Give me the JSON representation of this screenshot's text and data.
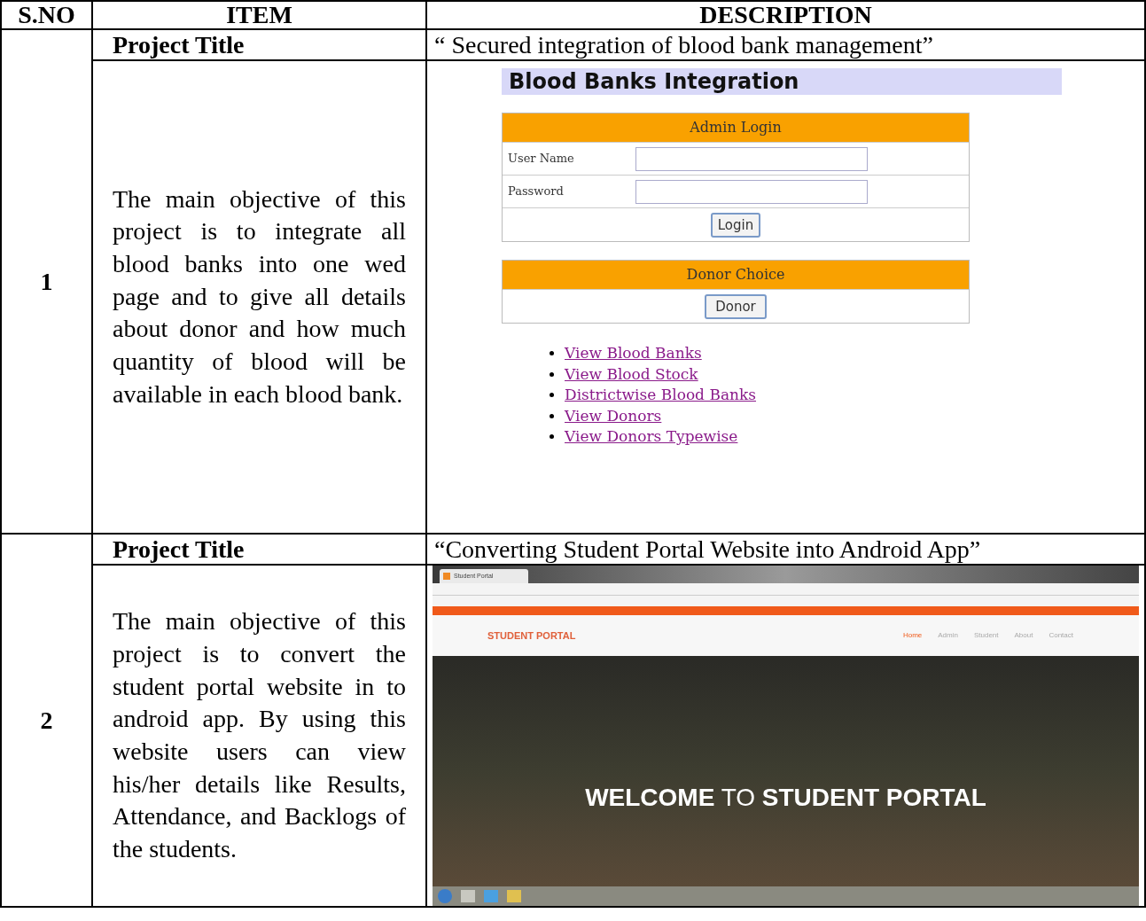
{
  "table": {
    "columns": [
      "S.NO",
      "ITEM",
      "DESCRIPTION"
    ],
    "rows": [
      {
        "number": "1",
        "title_label": "Project Title",
        "title": "“ Secured integration of blood bank management”",
        "objective": "The main objective of this project is to integrate all blood banks into one wed page and to give all details about donor and how much quantity of blood will be available in each blood bank.",
        "screenshot": {
          "kind": "blood_bank",
          "heading": "Blood Banks Integration",
          "login_header": "Admin Login",
          "fields": [
            {
              "label": "User Name"
            },
            {
              "label": "Password"
            }
          ],
          "login_button": "Login",
          "donor_header": "Donor Choice",
          "donor_button": "Donor",
          "links": [
            "View Blood Banks",
            "View Blood Stock",
            "Districtwise Blood Banks",
            "View Donors",
            "View Donors Typewise"
          ]
        }
      },
      {
        "number": "2",
        "title_label": "Project Title",
        "title": "“Converting Student Portal Website into Android App”",
        "objective": "The main objective of this project is to convert the student portal website in to android app. By using this website users can view his/her details like Results, Attendance, and Backlogs of the students.",
        "screenshot": {
          "kind": "student_portal",
          "tab_title": "Student Portal",
          "brand": "STUDENT PORTAL",
          "nav": [
            {
              "label": "Home",
              "selected": true
            },
            {
              "label": "Admin",
              "selected": false
            },
            {
              "label": "Student",
              "selected": false
            },
            {
              "label": "About",
              "selected": false
            },
            {
              "label": "Contact",
              "selected": false
            }
          ],
          "hero": "**WELCOME** TO **STUDENT PORTAL**"
        }
      }
    ]
  }
}
